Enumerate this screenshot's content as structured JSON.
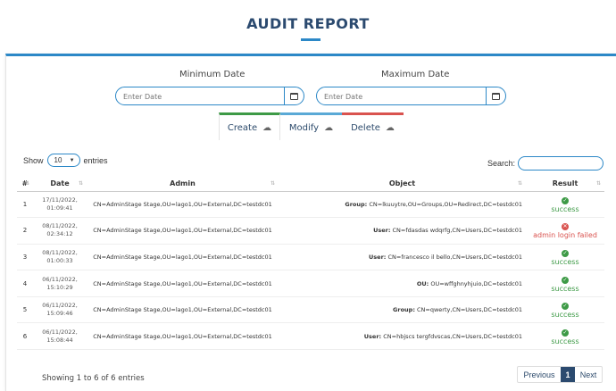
{
  "header": {
    "title": "AUDIT REPORT"
  },
  "filters": {
    "min_label": "Minimum Date",
    "max_label": "Maximum Date",
    "min_placeholder": "Enter Date",
    "max_placeholder": "Enter Date"
  },
  "tabs": [
    {
      "label": "Create",
      "accent": "#3d9a46"
    },
    {
      "label": "Modify",
      "accent": "#5aa9d6"
    },
    {
      "label": "Delete",
      "accent": "#d9534f"
    }
  ],
  "table_controls": {
    "show_label": "Show",
    "entries_value": "10",
    "entries_label": "entries",
    "search_label": "Search:"
  },
  "table": {
    "columns": [
      "#",
      "Date",
      "Admin",
      "Object",
      "Result"
    ],
    "rows": [
      {
        "num": "1",
        "date1": "17/11/2022,",
        "date2": "01:09:41",
        "admin": "CN=AdminStage Stage,OU=lago1,OU=External,DC=testdc01",
        "obj_type": "Group:",
        "obj_rest": "CN=lkuuytre,OU=Groups,OU=Redirect,DC=testdc01",
        "result": "success"
      },
      {
        "num": "2",
        "date1": "08/11/2022,",
        "date2": "02:34:12",
        "admin": "CN=AdminStage Stage,OU=lago1,OU=External,DC=testdc01",
        "obj_type": "User:",
        "obj_rest": "CN=fdasdas wdqrfg,CN=Users,DC=testdc01",
        "result": "admin login failed"
      },
      {
        "num": "3",
        "date1": "08/11/2022,",
        "date2": "01:00:33",
        "admin": "CN=AdminStage Stage,OU=lago1,OU=External,DC=testdc01",
        "obj_type": "User:",
        "obj_rest": "CN=francesco il bello,CN=Users,DC=testdc01",
        "result": "success"
      },
      {
        "num": "4",
        "date1": "06/11/2022,",
        "date2": "15:10:29",
        "admin": "CN=AdminStage Stage,OU=lago1,OU=External,DC=testdc01",
        "obj_type": "OU:",
        "obj_rest": "OU=wffghnyhjuio,DC=testdc01",
        "result": "success"
      },
      {
        "num": "5",
        "date1": "06/11/2022,",
        "date2": "15:09:46",
        "admin": "CN=AdminStage Stage,OU=lago1,OU=External,DC=testdc01",
        "obj_type": "Group:",
        "obj_rest": "CN=qwerty,CN=Users,DC=testdc01",
        "result": "success"
      },
      {
        "num": "6",
        "date1": "06/11/2022,",
        "date2": "15:08:44",
        "admin": "CN=AdminStage Stage,OU=lago1,OU=External,DC=testdc01",
        "obj_type": "User:",
        "obj_rest": "CN=hbjscs tergfdvscas,CN=Users,DC=testdc01",
        "result": "success"
      }
    ]
  },
  "footer": {
    "info": "Showing 1 to 6 of 6 entries",
    "prev": "Previous",
    "page": "1",
    "next": "Next"
  },
  "colors": {
    "brand": "#2b4a6f",
    "accent": "#2c88c7",
    "success": "#3d9a46",
    "error": "#d9534f"
  },
  "icons": [
    "calendar-icon",
    "cloud-upload-icon",
    "sort-icon",
    "chevron-down-icon",
    "check-circle-icon",
    "x-circle-icon"
  ]
}
